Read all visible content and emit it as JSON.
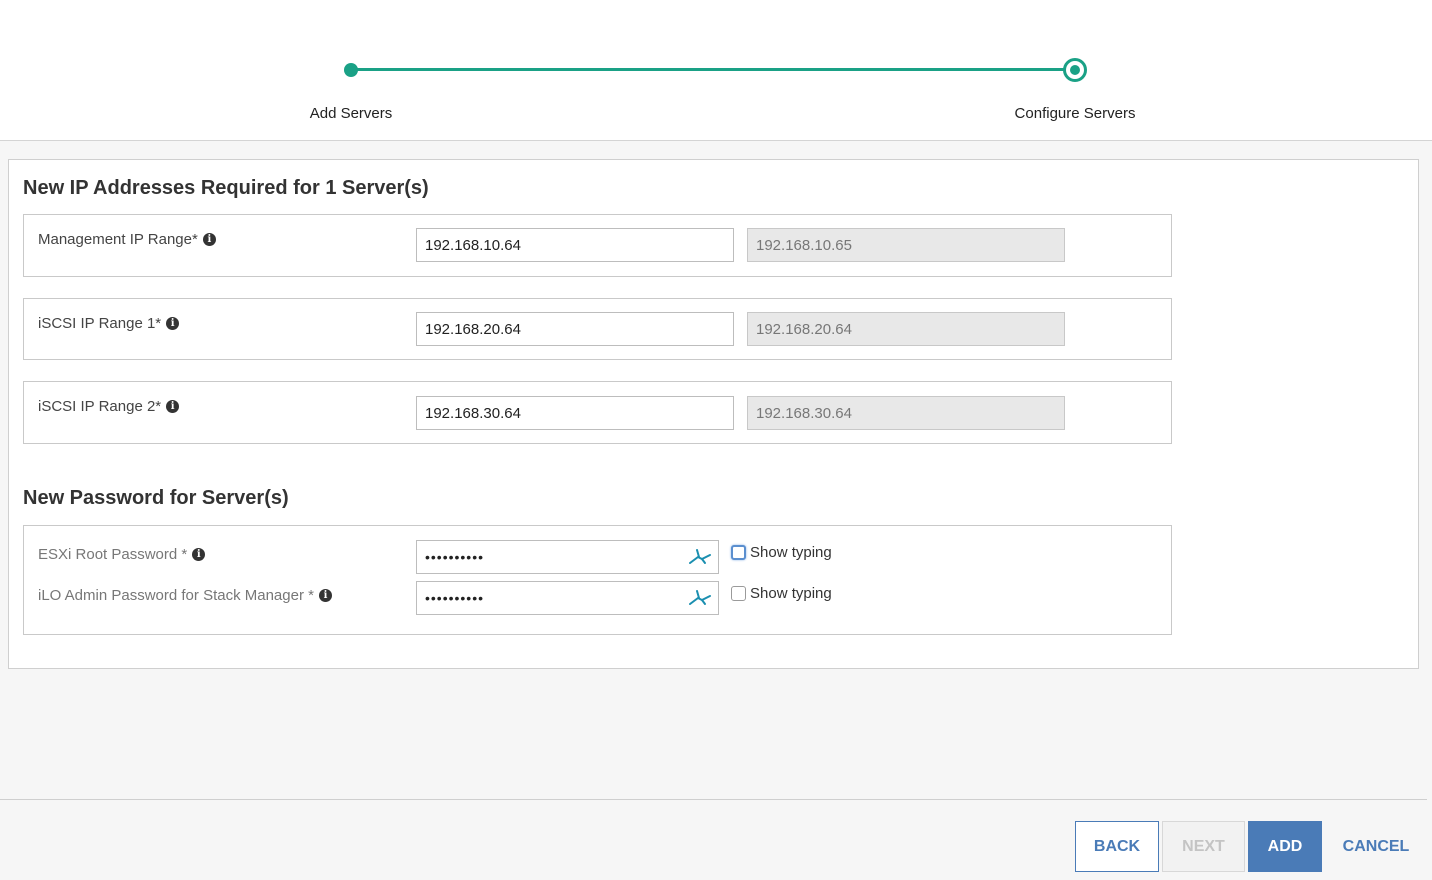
{
  "wizard": {
    "steps": [
      {
        "label": "Add Servers",
        "state": "done"
      },
      {
        "label": "Configure Servers",
        "state": "current"
      }
    ],
    "accent_color": "#1aa186"
  },
  "ip_section": {
    "title": "New IP Addresses Required for 1 Server(s)",
    "fields": [
      {
        "label": "Management IP Range*",
        "start_value": "192.168.10.64",
        "end_value": "192.168.10.65"
      },
      {
        "label": "iSCSI IP Range 1*",
        "start_value": "192.168.20.64",
        "end_value": "192.168.20.64"
      },
      {
        "label": "iSCSI IP Range 2*",
        "start_value": "192.168.30.64",
        "end_value": "192.168.30.64"
      }
    ]
  },
  "password_section": {
    "title": "New Password for Server(s)",
    "fields": [
      {
        "label": "ESXi Root Password *",
        "masked_value": "••••••••••",
        "show_typing_label": "Show typing",
        "show_typing_checked": false
      },
      {
        "label": "iLO Admin Password for Stack Manager *",
        "masked_value": "••••••••••",
        "show_typing_label": "Show typing",
        "show_typing_checked": false
      }
    ]
  },
  "footer": {
    "back_label": "BACK",
    "next_label": "NEXT",
    "add_label": "ADD",
    "cancel_label": "CANCEL",
    "primary_color": "#4a7bb7"
  }
}
